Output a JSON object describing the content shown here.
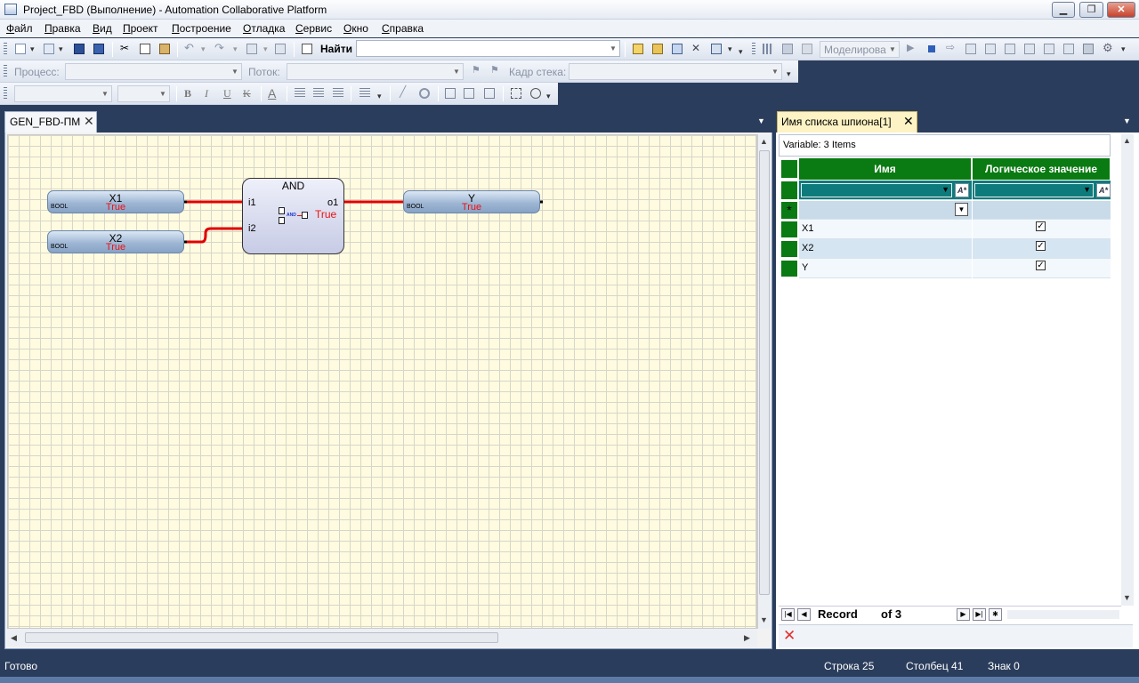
{
  "window": {
    "title": "Project_FBD (Выполнение) - Automation Collaborative Platform",
    "minimize": "▁",
    "restore": "❐",
    "close": "✕"
  },
  "menu": [
    "Файл",
    "Правка",
    "Вид",
    "Проект",
    "Построение",
    "Отладка",
    "Сервис",
    "Окно",
    "Справка"
  ],
  "toolbar": {
    "find_label": "Найти",
    "find_value": "",
    "sim_mode": "Моделирова"
  },
  "debugbar": {
    "process_label": "Процесс:",
    "thread_label": "Поток:",
    "stack_label": "Кадр стека:"
  },
  "formatbar": {
    "bold": "B",
    "italic": "I",
    "underline": "U",
    "strike": "K",
    "fontcolor": "A"
  },
  "document": {
    "tab_label": "GEN_FBD-ПМ",
    "variables": [
      {
        "name": "X1",
        "type": "BOOL",
        "value": "True"
      },
      {
        "name": "X2",
        "type": "BOOL",
        "value": "True"
      },
      {
        "name": "Y",
        "type": "BOOL",
        "value": "True"
      }
    ],
    "block": {
      "name": "AND",
      "inputs": [
        "i1",
        "i2"
      ],
      "output": "o1",
      "value": "True",
      "icon_text": "AND"
    }
  },
  "watch": {
    "tab_label": "Имя списка шпиона[1]",
    "summary": "Variable: 3 Items",
    "columns": [
      "Имя",
      "Логическое значение"
    ],
    "new_row_marker": "*",
    "filter_btn": "A*",
    "rows": [
      {
        "name": "X1",
        "checked": true
      },
      {
        "name": "X2",
        "checked": true
      },
      {
        "name": "Y",
        "checked": true
      }
    ],
    "nav": {
      "record_label": "Record",
      "of_label": "of 3"
    },
    "delete_icon": "✕"
  },
  "status": {
    "ready": "Готово",
    "line": "Строка 25",
    "col": "Столбец 41",
    "char": "Знак 0"
  },
  "colors": {
    "header_green": "#0a7a12",
    "filter_teal": "#0d7b7b",
    "wire_red": "#e00000",
    "grid_bg": "#fffbe0"
  }
}
